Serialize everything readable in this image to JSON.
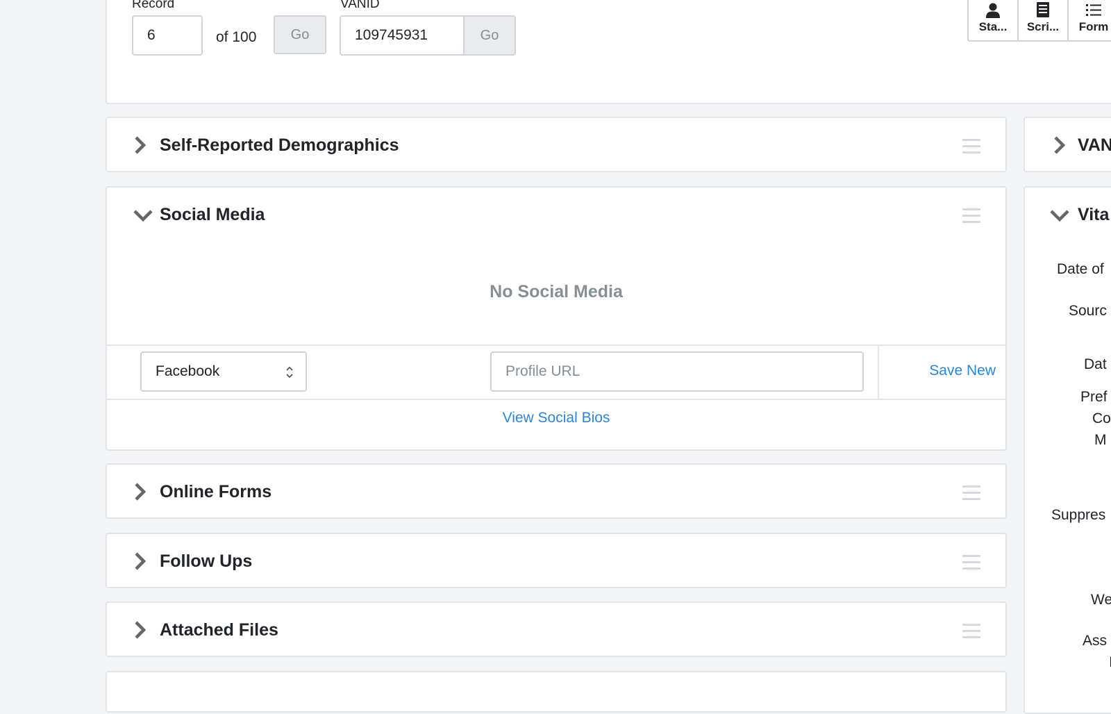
{
  "record_nav": {
    "record_label": "Record",
    "record_value": "6",
    "of_total": "of 100",
    "go_label": "Go",
    "vanid_label": "VANID",
    "vanid_value": "109745931",
    "vanid_go_label": "Go"
  },
  "toolbar": {
    "buttons": [
      {
        "label": "Sta...",
        "icon": "person-icon"
      },
      {
        "label": "Scri...",
        "icon": "script-icon"
      },
      {
        "label": "Form",
        "icon": "list-icon"
      }
    ]
  },
  "panels": {
    "demographics": {
      "title": "Self-Reported Demographics"
    },
    "social_media": {
      "title": "Social Media",
      "empty_message": "No Social Media",
      "network_select_value": "Facebook",
      "profile_url_placeholder": "Profile URL",
      "save_new_label": "Save New",
      "view_bios_label": "View Social Bios"
    },
    "online_forms": {
      "title": "Online Forms"
    },
    "follow_ups": {
      "title": "Follow Ups"
    },
    "attached_files": {
      "title": "Attached Files"
    }
  },
  "right_column": {
    "vanid_panel_title": "VAN",
    "vitals_panel_title": "Vita",
    "labels": [
      "Date of",
      "Sourc",
      "Dat",
      "Pref",
      "Co",
      "M",
      "Suppres",
      "We",
      "Ass",
      "I"
    ]
  }
}
